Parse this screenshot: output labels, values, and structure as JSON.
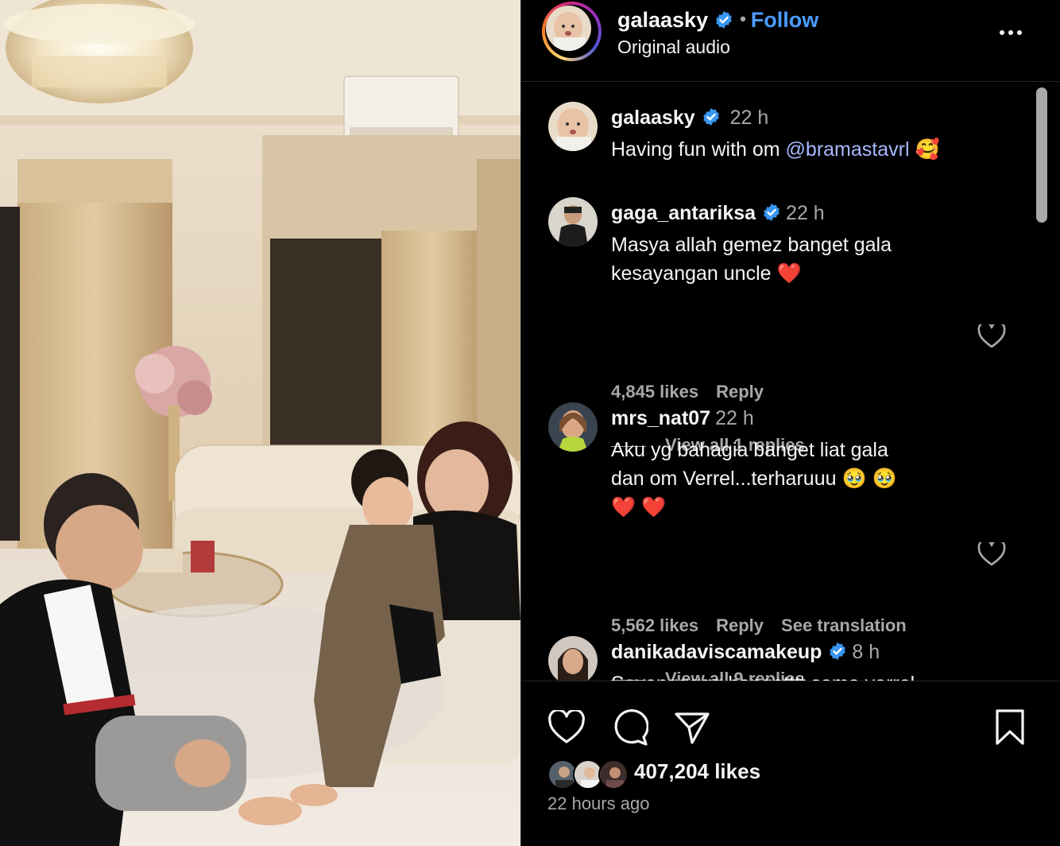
{
  "post": {
    "username": "galaasky",
    "follow_label": "Follow",
    "audio": "Original audio",
    "likes_count": "407,204 likes",
    "posted_ago": "22 hours ago"
  },
  "caption": {
    "username": "galaasky",
    "time": "22 h",
    "text": "Having fun with om ",
    "mention": "@bramastavrl",
    "emoji": "🥰"
  },
  "comments": [
    {
      "username": "gaga_antariksa",
      "verified": true,
      "time": "22 h",
      "text_line1": "Masya allah gemez banget gala",
      "text_line2": "kesayangan uncle ❤️",
      "likes": "4,845 likes",
      "reply_label": "Reply",
      "view_replies": "View all 1 replies"
    },
    {
      "username": "mrs_nat07",
      "verified": false,
      "time": "22 h",
      "text_line1": "Aku yg bahagia banget liat gala",
      "text_line2": "dan om Verrel...terharuuu 🥹 🥹",
      "text_line3": "❤️ ❤️",
      "likes": "5,562 likes",
      "reply_label": "Reply",
      "translate_label": "See translation",
      "view_replies": "View all 9 replies"
    },
    {
      "username": "danikadaviscamakeup",
      "verified": true,
      "time": "8 h",
      "text_line1": "Sayanggggg bangetttt sama verrel"
    }
  ],
  "icons": {
    "verified": "verified-badge-icon",
    "more": "more-options-icon",
    "like": "heart-icon",
    "comment": "comment-icon",
    "share": "share-icon",
    "save": "bookmark-icon"
  },
  "colors": {
    "background": "#000000",
    "link": "#4c9bff",
    "mention": "#a6b9ff",
    "verified": "#3897f0",
    "secondary_text": "#a8a8a8"
  }
}
